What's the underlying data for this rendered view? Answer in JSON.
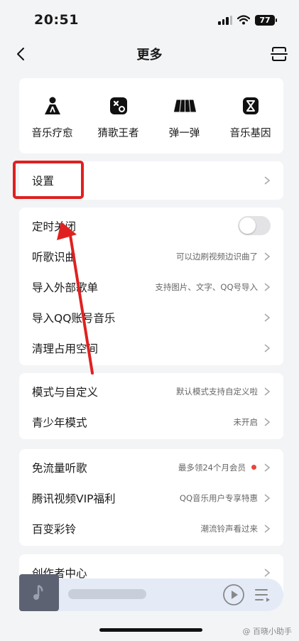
{
  "status_bar": {
    "time": "20:51",
    "battery": "77"
  },
  "nav": {
    "title": "更多"
  },
  "quick_actions": [
    {
      "label": "音乐疗愈",
      "icon": "person-icon"
    },
    {
      "label": "猜歌王者",
      "icon": "dice-icon"
    },
    {
      "label": "弹一弹",
      "icon": "piano-icon"
    },
    {
      "label": "音乐基因",
      "icon": "hourglass-icon"
    }
  ],
  "settings": {
    "label": "设置"
  },
  "group1": [
    {
      "label": "定时关闭",
      "hint": ""
    },
    {
      "label": "听歌识曲",
      "hint": "可以边刷视频边识曲了"
    },
    {
      "label": "导入外部歌单",
      "hint": "支持图片、文字、QQ号导入"
    },
    {
      "label": "导入QQ账号音乐",
      "hint": ""
    },
    {
      "label": "清理占用空间",
      "hint": ""
    }
  ],
  "group2": [
    {
      "label": "模式与自定义",
      "hint": "默认模式支持自定义啦"
    },
    {
      "label": "青少年模式",
      "hint": "未开启"
    }
  ],
  "group3": [
    {
      "label": "免流量听歌",
      "hint": "最多领24个月会员"
    },
    {
      "label": "腾讯视频VIP福利",
      "hint": "QQ音乐用户专享特惠"
    },
    {
      "label": "百变彩铃",
      "hint": "潮流铃声看过来"
    }
  ],
  "group4": [
    {
      "label": "创作者中心",
      "hint": ""
    }
  ],
  "watermark": "@ 百晓小助手",
  "colors": {
    "highlight": "#e02020",
    "accent_dot": "#e8453c",
    "background": "#f3f4f6"
  }
}
